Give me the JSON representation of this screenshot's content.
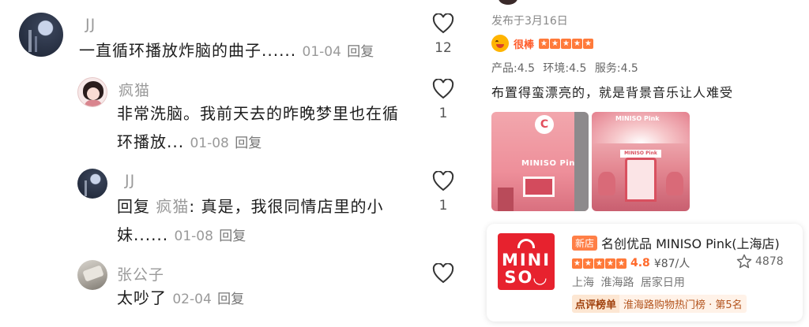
{
  "comments": [
    {
      "username": "JJ",
      "text": "一直循环播放炸脑的曲子......",
      "date": "01-04",
      "reply_label": "回复",
      "likes": "12"
    },
    {
      "username": "疯猫",
      "text_line1": "非常洗脑。我前天去的昨晚梦里也在循",
      "text_line2": "环播放...",
      "date": "01-08",
      "reply_label": "回复",
      "likes": "1"
    },
    {
      "username": "JJ",
      "reply_prefix": "回复",
      "reply_to": "疯猫",
      "text_line1": ": 真是，我很同情店里的小",
      "text_line2": "妹......",
      "date": "01-08",
      "reply_label": "回复",
      "likes": "1"
    },
    {
      "username": "张公子",
      "text": "太吵了",
      "date": "02-04",
      "reply_label": "回复",
      "likes": ""
    }
  ],
  "review": {
    "published": "发布于3月16日",
    "badge": "很棒",
    "stars": 5,
    "sub_scores": "产品:4.5 环境:4.5 服务:4.5",
    "text": "布置得蛮漂亮的，就是背景音乐让人难受",
    "photo1_sign": "MINISO Pink",
    "photo1_letter": "C",
    "photo2_sign": "MINISO Pink",
    "photo2_booth": "MINISO Pink"
  },
  "shop": {
    "logo_line1": "MINI",
    "logo_line2": "SO◡",
    "new_tag": "新店",
    "name": "名创优品 MINISO Pink(上海店)",
    "score": "4.8",
    "price": "¥87/人",
    "favorites": "4878",
    "location": "上海 淮海路 居家日用",
    "rank_tag": "点评榜单",
    "rank_text": "淮海路购物热门榜 · 第5名"
  },
  "colors": {
    "accent": "#ff6a2b",
    "miniso_red": "#e7222e",
    "muted_text": "#9a9a9a"
  },
  "icons": [
    "heart-icon",
    "star-icon",
    "smile-emoji-icon"
  ]
}
